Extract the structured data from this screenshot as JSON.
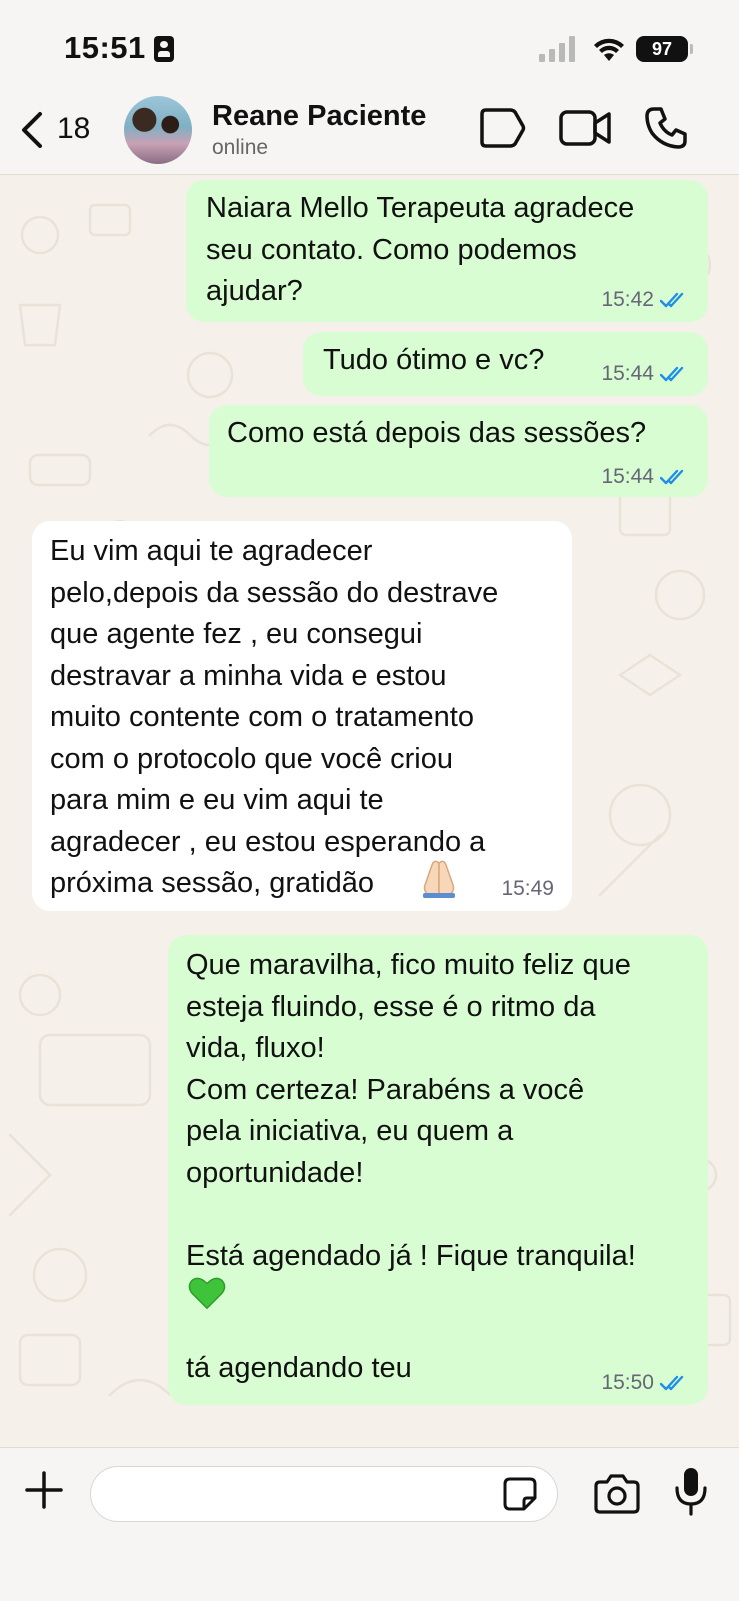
{
  "status_bar": {
    "time": "15:51",
    "battery": "97"
  },
  "header": {
    "back_count": "18",
    "contact_name": "Reane Paciente",
    "contact_status": "online"
  },
  "messages": [
    {
      "direction": "outgoing",
      "text": "Naiara Mello Terapeuta agradece\nseu contato. Como podemos\najudar?",
      "time": "15:42",
      "read": true
    },
    {
      "direction": "outgoing",
      "text": "Tudo ótimo e vc?",
      "time": "15:44",
      "read": true
    },
    {
      "direction": "outgoing",
      "text": "Como está depois das sessões?",
      "time": "15:44",
      "read": true
    },
    {
      "direction": "incoming",
      "text": "Eu vim aqui te agradecer\npelo,depois da sessão do destrave\nque agente fez , eu consegui\ndestravar a minha vida e estou\nmuito contente com o tratamento\ncom o protocolo que você criou\npara mim e eu vim aqui te\nagradecer , eu estou esperando a\npróxima sessão, gratidão",
      "emoji": "praying-hands",
      "time": "15:49"
    },
    {
      "direction": "outgoing",
      "text": "Que maravilha, fico muito feliz que\nesteja fluindo, esse é o ritmo da\nvida, fluxo!\nCom certeza! Parabéns a você\npela iniciativa, eu quem a\noportunidade!\n\nEstá agendado já ! Fique tranquila!",
      "emoji": "green-heart",
      "text_after": "tá agendando teu",
      "time": "15:50",
      "read": true
    }
  ],
  "colors": {
    "outgoing_bubble": "#d9fdd3",
    "incoming_bubble": "#ffffff",
    "read_ticks": "#1f8ee8",
    "wallpaper": "#f5f1ea"
  }
}
